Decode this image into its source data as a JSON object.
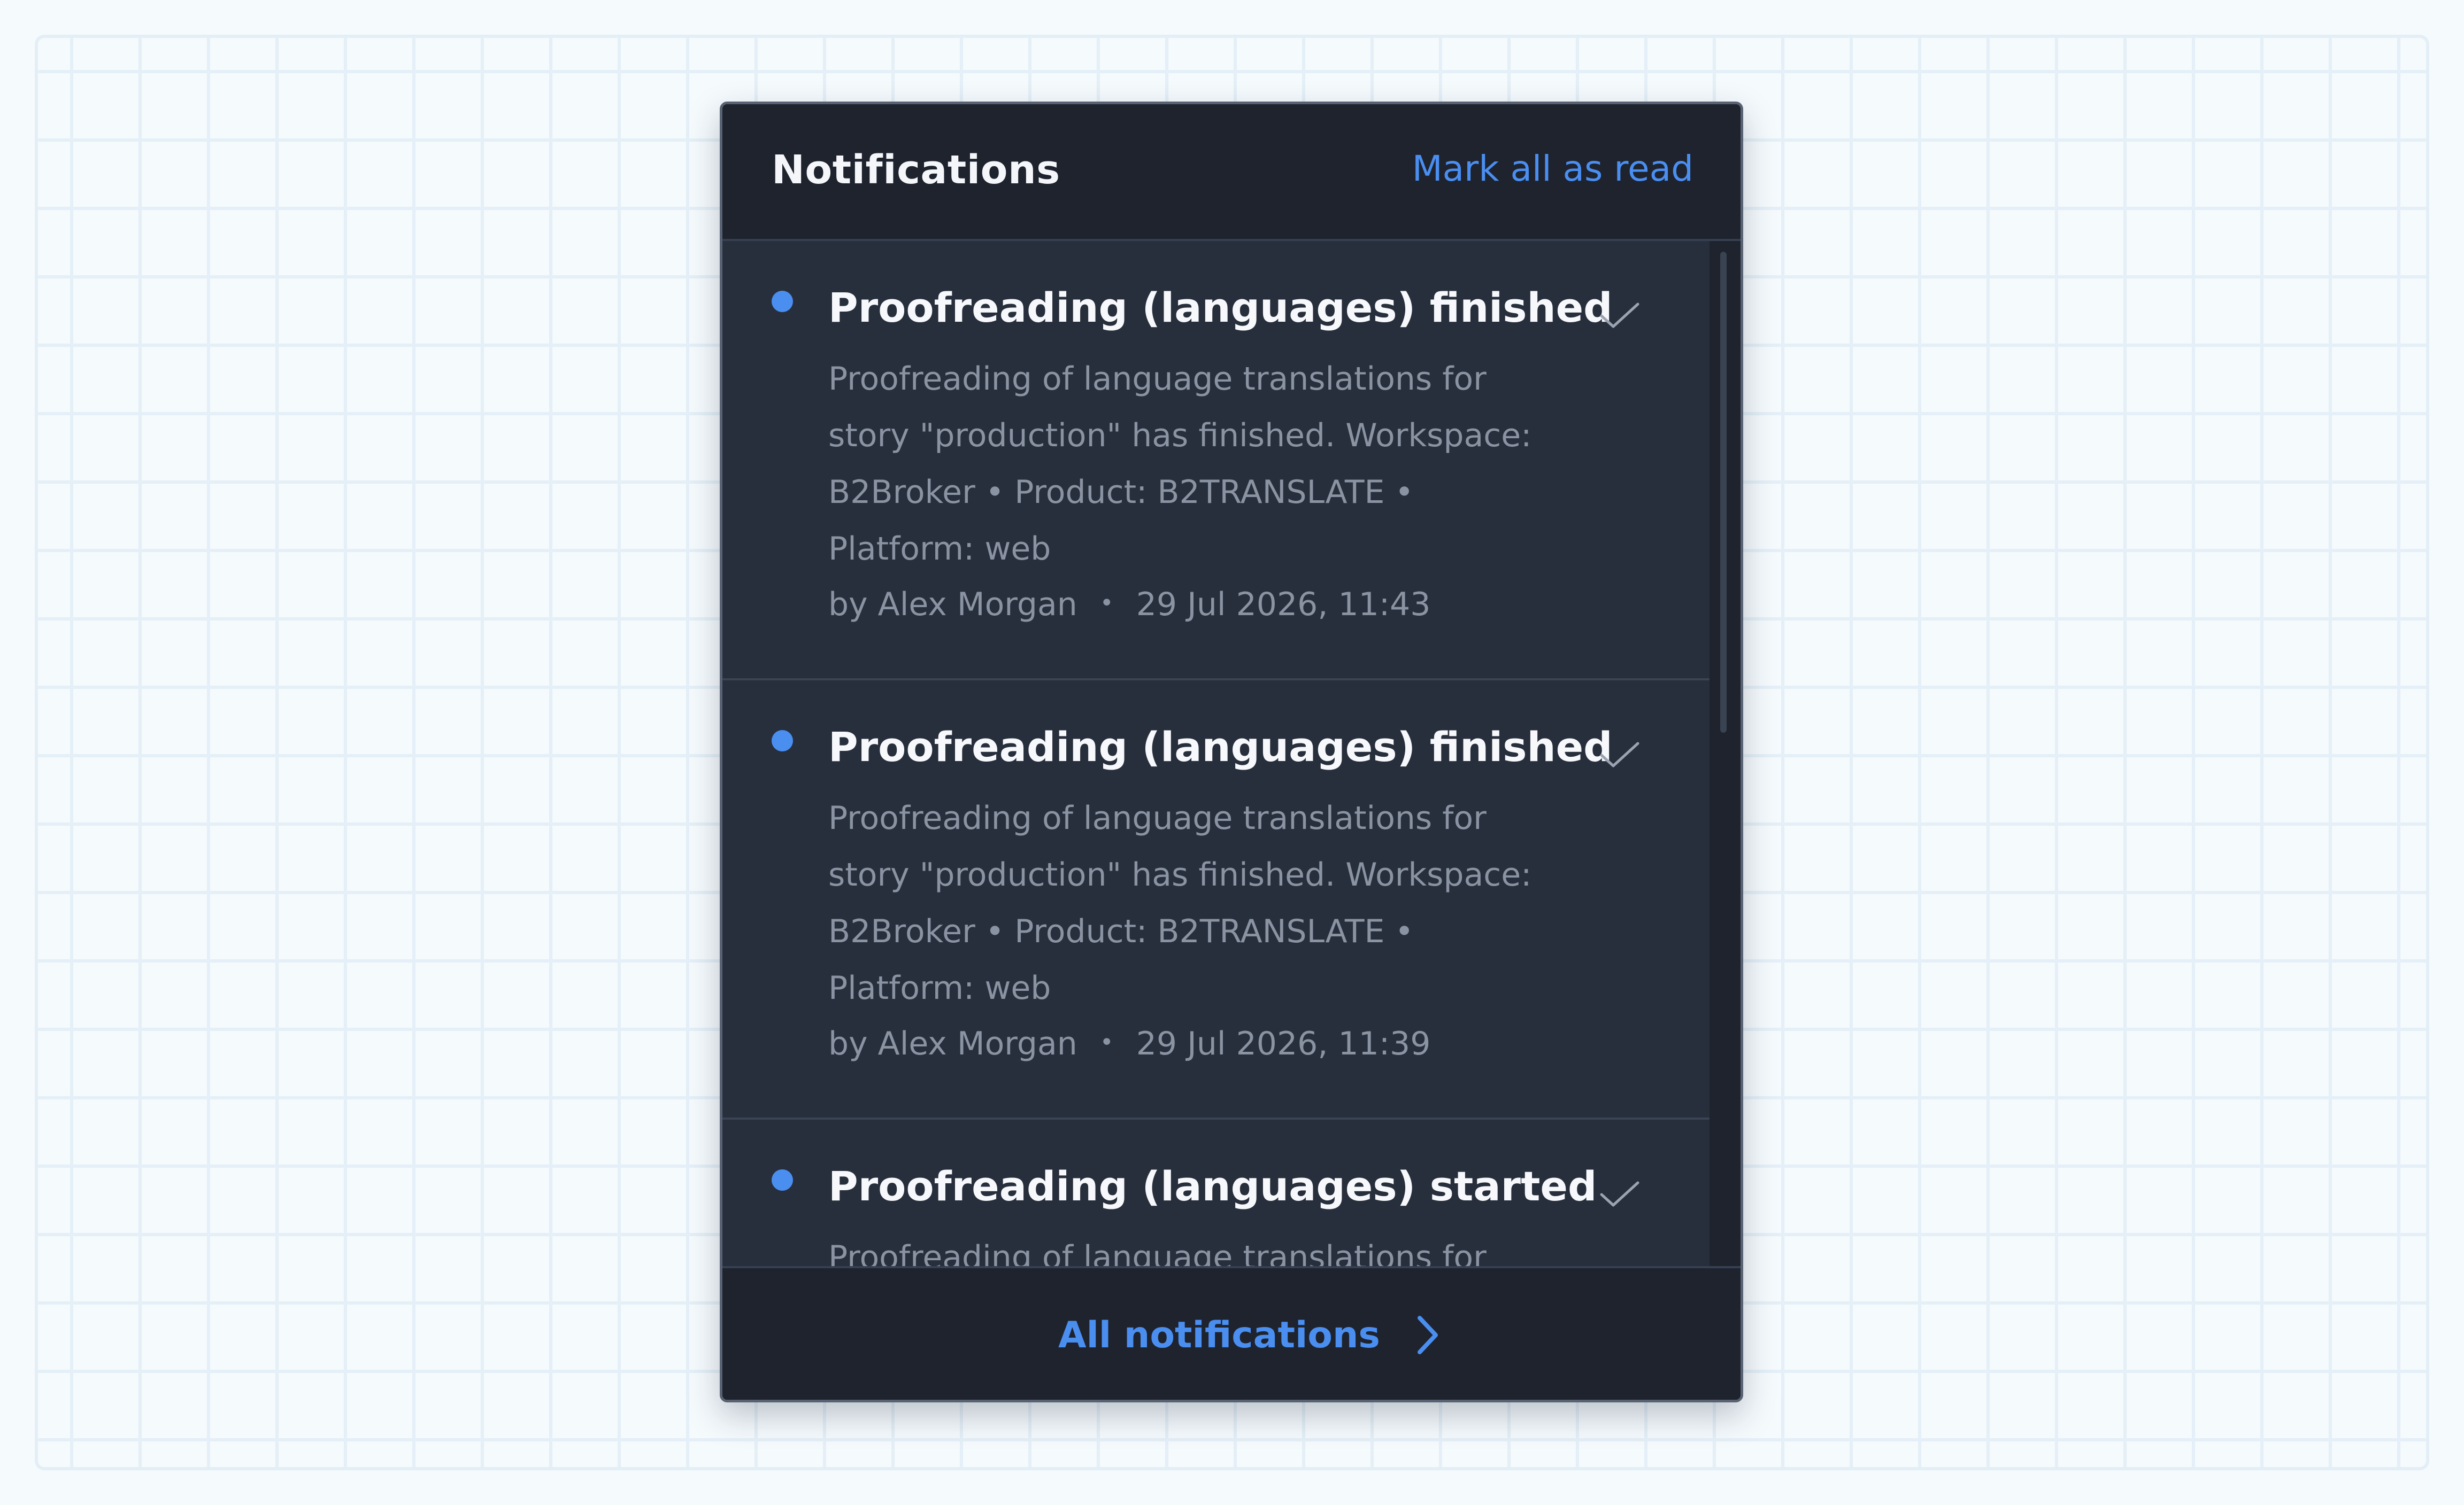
{
  "panel": {
    "title": "Notifications",
    "mark_all_label": "Mark all as read"
  },
  "notifications": [
    {
      "title": "Proofreading (languages) finished",
      "body": "Proofreading of language translations for story \"production\" has finished. Workspace: B2Broker • Product: B2TRANSLATE • Platform: web",
      "author": "by Alex Morgan",
      "separator": "•",
      "timestamp": "29 Jul 2026, 11:43",
      "unread": true
    },
    {
      "title": "Proofreading (languages) finished",
      "body": "Proofreading of language translations for story \"production\" has finished. Workspace: B2Broker • Product: B2TRANSLATE • Platform: web",
      "author": "by Alex Morgan",
      "separator": "•",
      "timestamp": "29 Jul 2026, 11:39",
      "unread": true
    },
    {
      "title": "Proofreading (languages) started",
      "body": "Proofreading of language translations for",
      "author": "",
      "separator": "",
      "timestamp": "",
      "unread": true
    }
  ],
  "footer": {
    "all_label": "All notifications"
  },
  "colors": {
    "accent": "#4a8ef0",
    "panel_bg": "#1e232e",
    "item_bg": "#282f3c",
    "muted_text": "#8a93a2"
  },
  "icons": {
    "unread": "unread-dot-icon",
    "mark_read": "check-icon",
    "footer": "chevron-right-icon"
  }
}
